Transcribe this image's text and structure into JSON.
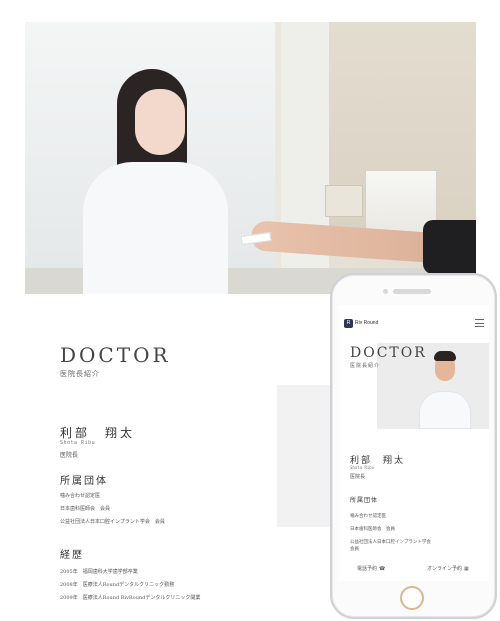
{
  "hero": {
    "image": "receptionist-handing-card-photo"
  },
  "doctor": {
    "title": "DOCTOR",
    "subtitle": "医院長紹介",
    "name": "利部　翔太",
    "name_roman": "Shota Ribu",
    "role": "医院長"
  },
  "affiliations": {
    "heading": "所属団体",
    "items": [
      "噛み合わせ認定医",
      "日本歯科医師会　会員",
      "公益社団法人日本口腔インプラント学会　会員"
    ]
  },
  "career": {
    "heading": "経歴",
    "items": [
      "2005年　福岡歯科大学歯学部卒業",
      "2008年　医療法人Roundデンタルクリニック勤務",
      "2009年　医療法人Round RivRoundデンタルクリニック開業"
    ]
  },
  "mobile": {
    "logo_text": "Riv Round",
    "logo_mark": "R",
    "title": "DOCTOR",
    "subtitle": "医院長紹介",
    "name": "利部　翔太",
    "name_roman": "Shota Ribu",
    "role": "医院長",
    "affiliations_heading": "所属団体",
    "affiliations": [
      "噛み合わせ認定医",
      "日本歯科医師会　会員",
      "公益社団法人日本口腔インプラント学会",
      "会員"
    ],
    "phone_button": "電話予約",
    "online_button": "オンライン予約"
  }
}
